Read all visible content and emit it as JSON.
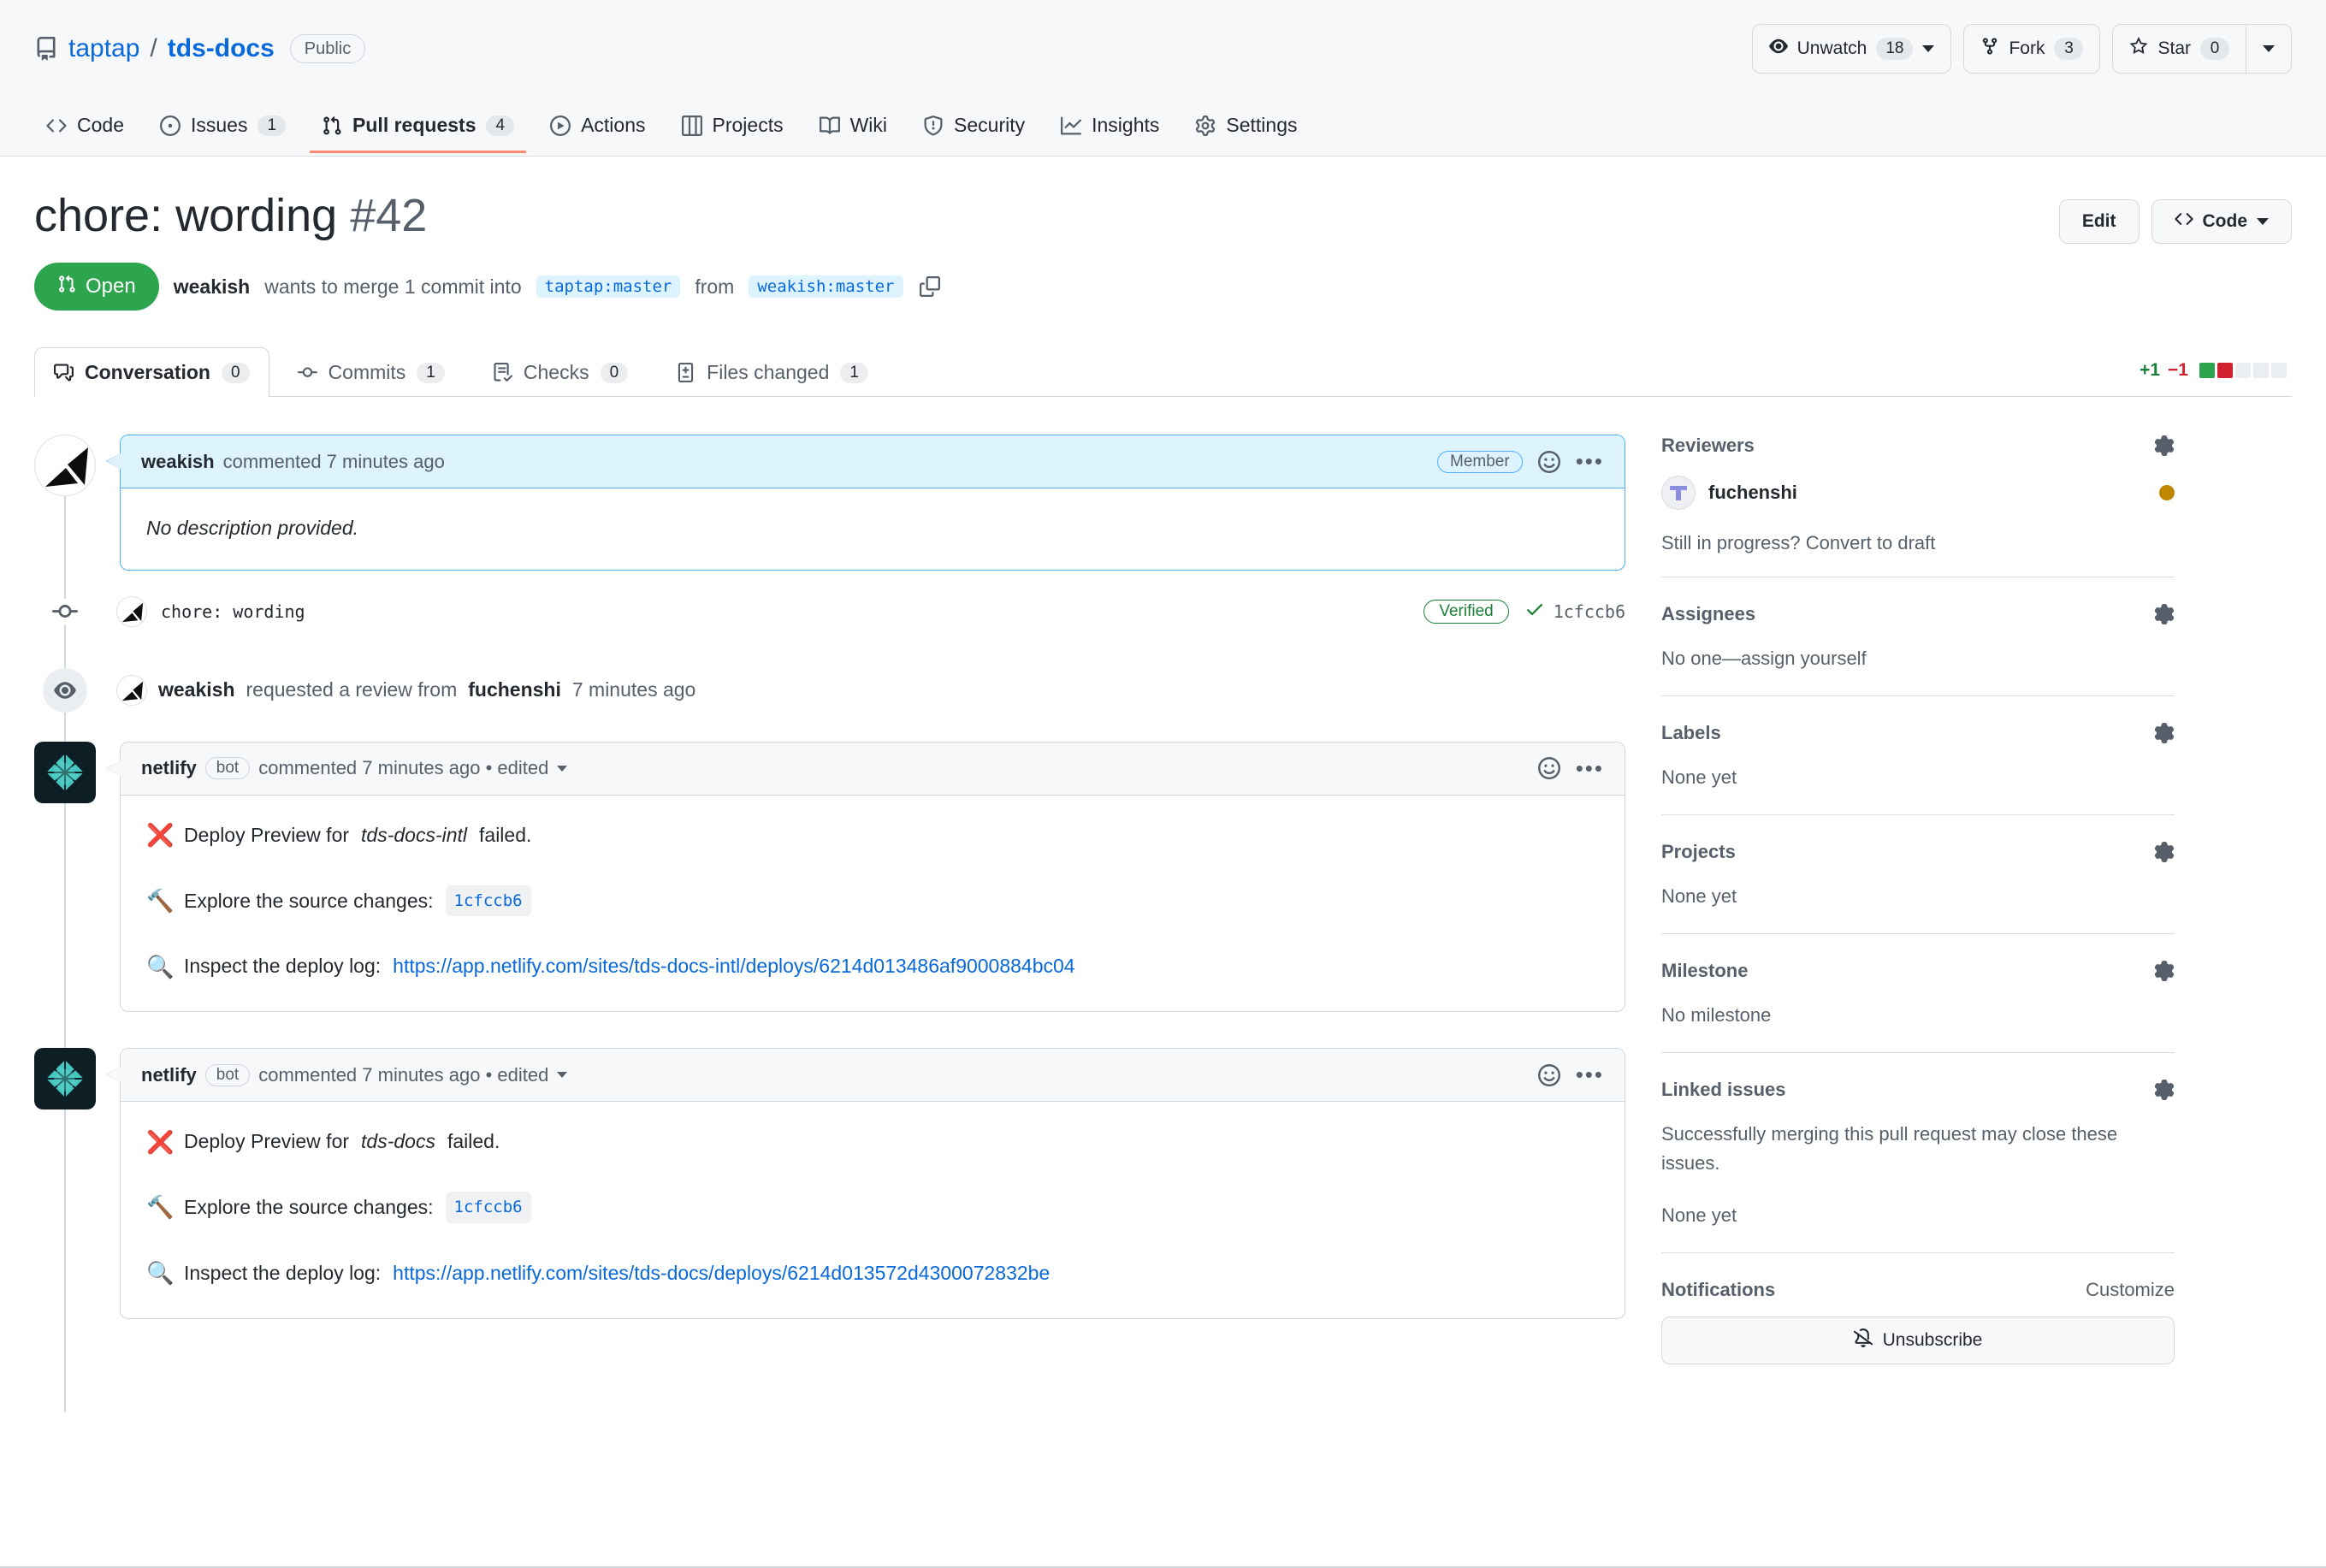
{
  "repo": {
    "owner": "taptap",
    "separator": "/",
    "name": "tds-docs",
    "visibility": "Public",
    "watch": {
      "label": "Unwatch",
      "count": "18"
    },
    "fork": {
      "label": "Fork",
      "count": "3"
    },
    "star": {
      "label": "Star",
      "count": "0"
    },
    "nav": [
      {
        "label": "Code",
        "icon": "code-icon",
        "count": ""
      },
      {
        "label": "Issues",
        "icon": "issue-opened-icon",
        "count": "1"
      },
      {
        "label": "Pull requests",
        "icon": "git-pull-request-icon",
        "count": "4"
      },
      {
        "label": "Actions",
        "icon": "play-icon",
        "count": ""
      },
      {
        "label": "Projects",
        "icon": "table-icon",
        "count": ""
      },
      {
        "label": "Wiki",
        "icon": "book-icon",
        "count": ""
      },
      {
        "label": "Security",
        "icon": "shield-icon",
        "count": ""
      },
      {
        "label": "Insights",
        "icon": "graph-icon",
        "count": ""
      },
      {
        "label": "Settings",
        "icon": "gear-icon",
        "count": ""
      }
    ]
  },
  "pr": {
    "title": "chore: wording",
    "number": "#42",
    "edit_label": "Edit",
    "code_label": "Code",
    "state": "Open",
    "meta_author": "weakish",
    "meta_text_1": "wants to merge 1 commit into",
    "base_branch": "taptap:master",
    "meta_text_2": "from",
    "head_branch": "weakish:master",
    "tabs": [
      {
        "label": "Conversation",
        "count": "0",
        "icon": "comment-discussion-icon"
      },
      {
        "label": "Commits",
        "count": "1",
        "icon": "git-commit-icon"
      },
      {
        "label": "Checks",
        "count": "0",
        "icon": "checklist-icon"
      },
      {
        "label": "Files changed",
        "count": "1",
        "icon": "file-diff-icon"
      }
    ],
    "diffstat": {
      "additions": "+1",
      "deletions": "−1"
    }
  },
  "timeline": {
    "first_comment": {
      "author": "weakish",
      "action": "commented 7 minutes ago",
      "badge": "Member",
      "body": "No description provided."
    },
    "commit": {
      "message": "chore: wording",
      "verified": "Verified",
      "sha": "1cfccb6"
    },
    "review_request": {
      "actor": "weakish",
      "text_1": "requested a review from",
      "reviewer": "fuchenshi",
      "time": "7 minutes ago"
    },
    "netlify_comments": [
      {
        "author": "netlify",
        "badge": "bot",
        "action": "commented 7 minutes ago • edited",
        "deploy_status_text_1": "Deploy Preview for",
        "site": "tds-docs-intl",
        "deploy_status_text_2": "failed.",
        "explore_label": "Explore the source changes:",
        "explore_sha": "1cfccb6",
        "inspect_label": "Inspect the deploy log:",
        "inspect_url": "https://app.netlify.com/sites/tds-docs-intl/deploys/6214d013486af9000884bc04"
      },
      {
        "author": "netlify",
        "badge": "bot",
        "action": "commented 7 minutes ago • edited",
        "deploy_status_text_1": "Deploy Preview for",
        "site": "tds-docs",
        "deploy_status_text_2": "failed.",
        "explore_label": "Explore the source changes:",
        "explore_sha": "1cfccb6",
        "inspect_label": "Inspect the deploy log:",
        "inspect_url": "https://app.netlify.com/sites/tds-docs/deploys/6214d013572d4300072832be"
      }
    ]
  },
  "sidebar": {
    "reviewers": {
      "title": "Reviewers",
      "name": "fuchenshi",
      "hint": "Still in progress? Convert to draft"
    },
    "assignees": {
      "title": "Assignees",
      "empty": "No one—assign yourself"
    },
    "labels": {
      "title": "Labels",
      "empty": "None yet"
    },
    "projects": {
      "title": "Projects",
      "empty": "None yet"
    },
    "milestone": {
      "title": "Milestone",
      "empty": "No milestone"
    },
    "linked_issues": {
      "title": "Linked issues",
      "desc": "Successfully merging this pull request may close these issues.",
      "empty": "None yet"
    },
    "notifications": {
      "title": "Notifications",
      "customize": "Customize",
      "button": "Unsubscribe"
    }
  },
  "colors": {
    "open_green": "#2da44e",
    "accent_blue": "#0969da",
    "tab_underline": "#fd8c73",
    "pending_amber": "#bf8700",
    "verified_green": "#1a7f37",
    "deletion_red": "#cf222e"
  }
}
